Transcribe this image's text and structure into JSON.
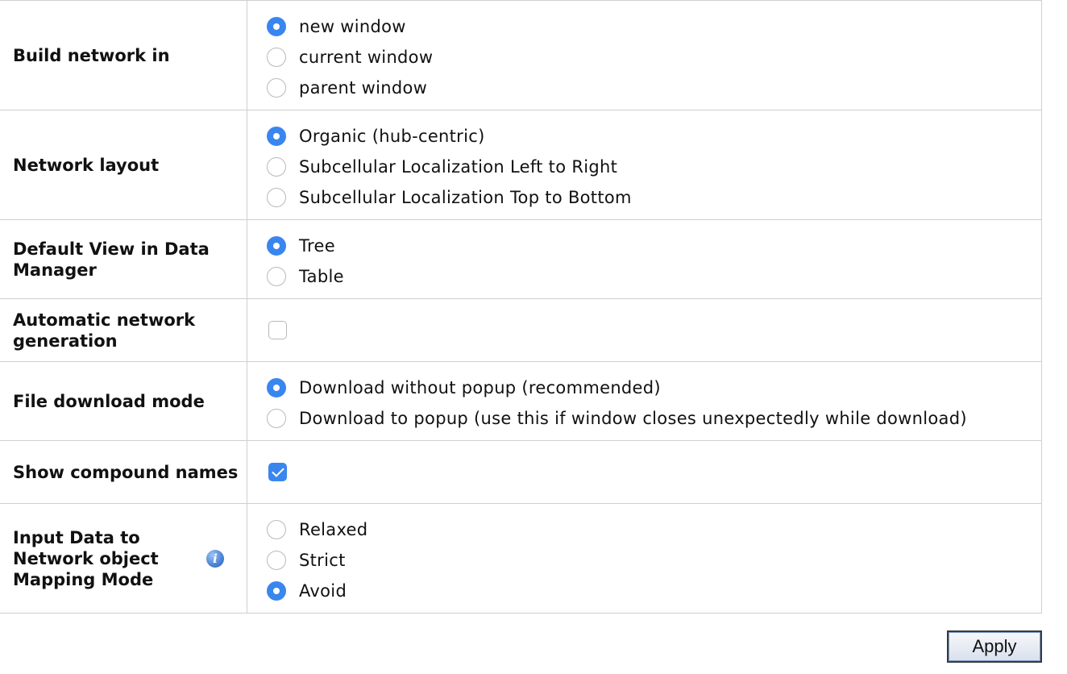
{
  "settings": {
    "build_network_in": {
      "label": "Build network in",
      "options": [
        "new window",
        "current window",
        "parent window"
      ],
      "selected": "new window"
    },
    "network_layout": {
      "label": "Network layout",
      "options": [
        "Organic (hub-centric)",
        "Subcellular Localization Left to Right",
        "Subcellular Localization Top to Bottom"
      ],
      "selected": "Organic (hub-centric)"
    },
    "default_view": {
      "label": "Default View in Data Manager",
      "options": [
        "Tree",
        "Table"
      ],
      "selected": "Tree"
    },
    "automatic_network_generation": {
      "label": "Automatic network generation",
      "checked": false
    },
    "file_download_mode": {
      "label": "File download mode",
      "options": [
        "Download without popup (recommended)",
        "Download to popup (use this if window closes unexpectedly while download)"
      ],
      "selected": "Download without popup (recommended)"
    },
    "show_compound_names": {
      "label": "Show compound names",
      "checked": true
    },
    "mapping_mode": {
      "label": "Input Data to Network object Mapping Mode",
      "info_icon": "info-icon",
      "info_glyph": "i",
      "options": [
        "Relaxed",
        "Strict",
        "Avoid"
      ],
      "selected": "Avoid"
    }
  },
  "apply_label": "Apply",
  "colors": {
    "accent": "#3a86ef",
    "border": "#cfcfcf"
  }
}
